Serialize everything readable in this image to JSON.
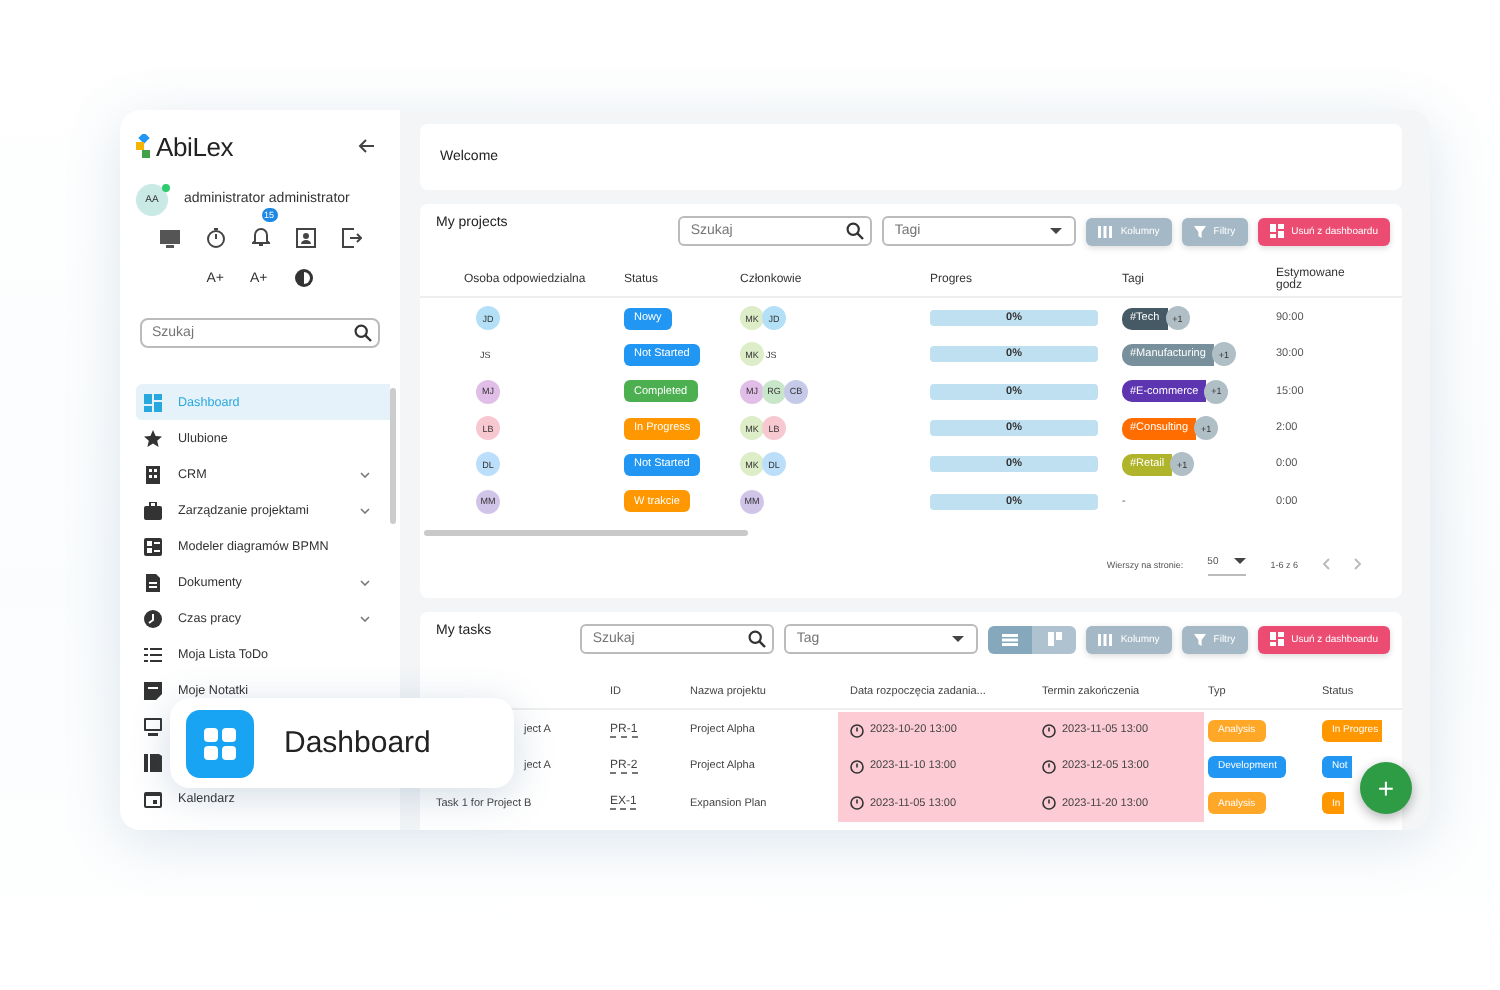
{
  "sidebar": {
    "logo": "AbiLex",
    "user": {
      "initials": "AA",
      "name": "administrator administrator",
      "online": true
    },
    "notifications": "15",
    "font_buttons": [
      "A+",
      "A+"
    ],
    "search": {
      "placeholder": "Szukaj"
    },
    "nav": [
      {
        "label": "Dashboard",
        "selected": true,
        "submenu": false
      },
      {
        "label": "Ulubione",
        "selected": false,
        "submenu": false
      },
      {
        "label": "CRM",
        "selected": false,
        "submenu": true
      },
      {
        "label": "Zarządzanie projektami",
        "selected": false,
        "submenu": true
      },
      {
        "label": "Modeler diagramów BPMN",
        "selected": false,
        "submenu": false
      },
      {
        "label": "Dokumenty",
        "selected": false,
        "submenu": true
      },
      {
        "label": "Czas pracy",
        "selected": false,
        "submenu": true
      },
      {
        "label": "Moja Lista ToDo",
        "selected": false,
        "submenu": false
      },
      {
        "label": "Moje Notatki",
        "selected": false,
        "submenu": false
      },
      {
        "selected": false,
        "submenu": false
      },
      {
        "selected": false,
        "submenu": false
      },
      {
        "label": "Kalendarz",
        "selected": false,
        "submenu": false
      }
    ]
  },
  "welcome": {
    "title": "Welcome"
  },
  "projects": {
    "title": "My projects",
    "search": {
      "placeholder": "Szukaj"
    },
    "tags_field": {
      "placeholder": "Tagi"
    },
    "buttons": [
      {
        "label": "Kolumny",
        "kind": "columns"
      },
      {
        "label": "Filtry",
        "kind": "filter"
      },
      {
        "label": "Usuń z dashboardu",
        "kind": "remove"
      }
    ],
    "columns": [
      "Osoba odpowiedzialna",
      "Status",
      "Członkowie",
      "Progres",
      "Tagi",
      "Estymowane godz"
    ],
    "rows": [
      {
        "owner": {
          "initials": "JD",
          "color": "#b3e0f7"
        },
        "status": {
          "label": "Nowy",
          "color": "#2196f3"
        },
        "members": [
          {
            "initials": "MK",
            "color": "#dcedc8"
          },
          {
            "initials": "JD",
            "color": "#b3e0f7"
          }
        ],
        "progress": {
          "level": 0,
          "text": "0%"
        },
        "tag": {
          "label": "#Tech",
          "color": "#455a64",
          "more": "+1"
        },
        "hours": "90:00"
      },
      {
        "owner": {
          "initials": "JS"
        },
        "status": {
          "label": "Not Started",
          "color": "#2196f3"
        },
        "members": [
          {
            "initials": "MK",
            "color": "#dcedc8"
          },
          {
            "initials": "JS"
          }
        ],
        "progress": {
          "level": 0,
          "text": "0%"
        },
        "tag": {
          "label": "#Manufacturing",
          "color": "#78909c",
          "more": "+1"
        },
        "hours": "30:00"
      },
      {
        "owner": {
          "initials": "MJ",
          "color": "#e1bee7"
        },
        "status": {
          "label": "Completed",
          "color": "#4caf50"
        },
        "members": [
          {
            "initials": "MJ",
            "color": "#e1bee7"
          },
          {
            "initials": "RG",
            "color": "#c8e6c9"
          },
          {
            "initials": "CB",
            "color": "#c5cae9"
          }
        ],
        "progress": {
          "level": 0,
          "text": "0%"
        },
        "tag": {
          "label": "#E-commerce",
          "color": "#5e35b1",
          "more": "+1"
        },
        "hours": "15:00"
      },
      {
        "owner": {
          "initials": "LB",
          "color": "#f8c8d0"
        },
        "status": {
          "label": "In Progress",
          "color": "#ff9800"
        },
        "members": [
          {
            "initials": "MK",
            "color": "#dcedc8"
          },
          {
            "initials": "LB",
            "color": "#f8c8d0"
          }
        ],
        "progress": {
          "level": 0,
          "text": "0%"
        },
        "tag": {
          "label": "#Consulting",
          "color": "#ff6d00",
          "more": "+1"
        },
        "hours": "2:00"
      },
      {
        "owner": {
          "initials": "DL",
          "color": "#bbdefb"
        },
        "status": {
          "label": "Not Started",
          "color": "#2196f3"
        },
        "members": [
          {
            "initials": "MK",
            "color": "#dcedc8"
          },
          {
            "initials": "DL",
            "color": "#bbdefb"
          }
        ],
        "progress": {
          "level": 0,
          "text": "0%"
        },
        "tag": {
          "label": "#Retail",
          "color": "#afb42b",
          "more": "+1"
        },
        "hours": "0:00"
      },
      {
        "owner": {
          "initials": "MM",
          "color": "#d1c4e9"
        },
        "status": {
          "label": "W trakcie",
          "color": "#ff9800"
        },
        "members": [
          {
            "initials": "MM",
            "color": "#d1c4e9"
          }
        ],
        "progress": {
          "level": 0,
          "text": "0%"
        },
        "no_tag": "-",
        "hours": "0:00"
      }
    ],
    "pagination": {
      "label": "Wierszy na stronie:",
      "per_page": "50",
      "range": "1-6 z 6"
    }
  },
  "tasks": {
    "title": "My tasks",
    "search": {
      "placeholder": "Szukaj"
    },
    "tag_field": {
      "placeholder": "Tag"
    },
    "views": [
      {
        "kind": "list",
        "selected": true
      },
      {
        "kind": "board",
        "selected": false
      }
    ],
    "buttons": [
      {
        "label": "Kolumny",
        "kind": "columns"
      },
      {
        "label": "Filtry",
        "kind": "filter"
      },
      {
        "label": "Usuń z dashboardu",
        "kind": "remove"
      }
    ],
    "columns": [
      "ID",
      "Nazwa projektu",
      "Data rozpoczęcia zadania...",
      "Termin zakończenia",
      "Typ",
      "Status"
    ],
    "rows": [
      {
        "name": "ject A",
        "covered": true,
        "id": "PR-1",
        "project": "Project Alpha",
        "start": "2023-10-20 13:00",
        "end": "2023-11-05 13:00",
        "overdue": true,
        "type": {
          "label": "Analysis",
          "color": "#ffa726"
        },
        "status": {
          "label": "In Progres",
          "color": "#ff9800"
        }
      },
      {
        "name": "ject A",
        "covered": true,
        "id": "PR-2",
        "project": "Project Alpha",
        "start": "2023-11-10 13:00",
        "end": "2023-12-05 13:00",
        "overdue": true,
        "type": {
          "label": "Development",
          "color": "#2196f3"
        },
        "status": {
          "label": "Not",
          "color": "#2196f3"
        }
      },
      {
        "name": "Task 1 for Project B",
        "covered": false,
        "id": "EX-1",
        "project": "Expansion Plan",
        "start": "2023-11-05 13:00",
        "end": "2023-11-20 13:00",
        "overdue": true,
        "type": {
          "label": "Analysis",
          "color": "#ffa726"
        },
        "status": {
          "label": "In",
          "color": "#ff9800"
        }
      }
    ]
  },
  "badge": {
    "label": "Dashboard"
  },
  "fab": {
    "label": "+"
  }
}
